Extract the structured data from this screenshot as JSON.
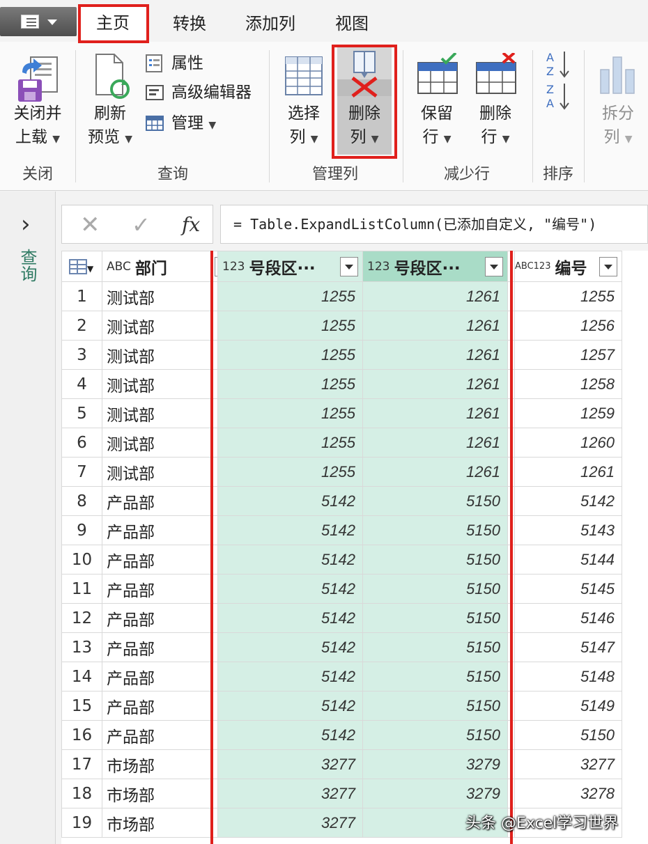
{
  "tabs": {
    "home": "主页",
    "transform": "转换",
    "add_column": "添加列",
    "view": "视图"
  },
  "ribbon": {
    "close_group": {
      "label": "关闭",
      "close_load_line1": "关闭并",
      "close_load_line2": "上载"
    },
    "query_group": {
      "label": "查询",
      "refresh_line1": "刷新",
      "refresh_line2": "预览",
      "properties": "属性",
      "advanced_editor": "高级编辑器",
      "manage": "管理"
    },
    "manage_columns_group": {
      "label": "管理列",
      "choose_line1": "选择",
      "choose_line2": "列",
      "remove_line1": "删除",
      "remove_line2": "列"
    },
    "reduce_rows_group": {
      "label": "减少行",
      "keep_line1": "保留",
      "keep_line2": "行",
      "remove_line1": "删除",
      "remove_line2": "行"
    },
    "sort_group": {
      "label": "排序"
    },
    "split_column": {
      "line1": "拆分",
      "line2": "列"
    }
  },
  "nav_pane": {
    "label": "查询"
  },
  "formula_bar": {
    "formula": "= Table.ExpandListColumn(已添加自定义, \"编号\")"
  },
  "table": {
    "columns": [
      {
        "type_icon": "ABC",
        "name": "部门"
      },
      {
        "type_icon": "123",
        "name": "号段区···"
      },
      {
        "type_icon": "123",
        "name": "号段区···"
      },
      {
        "type_icon": "ABC123",
        "name": "编号"
      }
    ],
    "rows": [
      {
        "n": "1",
        "dept": "测试部",
        "a": "1255",
        "b": "1261",
        "id": "1255"
      },
      {
        "n": "2",
        "dept": "测试部",
        "a": "1255",
        "b": "1261",
        "id": "1256"
      },
      {
        "n": "3",
        "dept": "测试部",
        "a": "1255",
        "b": "1261",
        "id": "1257"
      },
      {
        "n": "4",
        "dept": "测试部",
        "a": "1255",
        "b": "1261",
        "id": "1258"
      },
      {
        "n": "5",
        "dept": "测试部",
        "a": "1255",
        "b": "1261",
        "id": "1259"
      },
      {
        "n": "6",
        "dept": "测试部",
        "a": "1255",
        "b": "1261",
        "id": "1260"
      },
      {
        "n": "7",
        "dept": "测试部",
        "a": "1255",
        "b": "1261",
        "id": "1261"
      },
      {
        "n": "8",
        "dept": "产品部",
        "a": "5142",
        "b": "5150",
        "id": "5142"
      },
      {
        "n": "9",
        "dept": "产品部",
        "a": "5142",
        "b": "5150",
        "id": "5143"
      },
      {
        "n": "10",
        "dept": "产品部",
        "a": "5142",
        "b": "5150",
        "id": "5144"
      },
      {
        "n": "11",
        "dept": "产品部",
        "a": "5142",
        "b": "5150",
        "id": "5145"
      },
      {
        "n": "12",
        "dept": "产品部",
        "a": "5142",
        "b": "5150",
        "id": "5146"
      },
      {
        "n": "13",
        "dept": "产品部",
        "a": "5142",
        "b": "5150",
        "id": "5147"
      },
      {
        "n": "14",
        "dept": "产品部",
        "a": "5142",
        "b": "5150",
        "id": "5148"
      },
      {
        "n": "15",
        "dept": "产品部",
        "a": "5142",
        "b": "5150",
        "id": "5149"
      },
      {
        "n": "16",
        "dept": "产品部",
        "a": "5142",
        "b": "5150",
        "id": "5150"
      },
      {
        "n": "17",
        "dept": "市场部",
        "a": "3277",
        "b": "3279",
        "id": "3277"
      },
      {
        "n": "18",
        "dept": "市场部",
        "a": "3277",
        "b": "3279",
        "id": "3278"
      },
      {
        "n": "19",
        "dept": "市场部",
        "a": "3277",
        "b": "",
        "id": ""
      }
    ]
  },
  "watermark": "头条 @Excel学习世界",
  "colors": {
    "selected_fill": "#d5efe5",
    "selected_header": "#a9dcc7",
    "annotation_red": "#e0201c",
    "nav_label": "#2f7a63"
  }
}
